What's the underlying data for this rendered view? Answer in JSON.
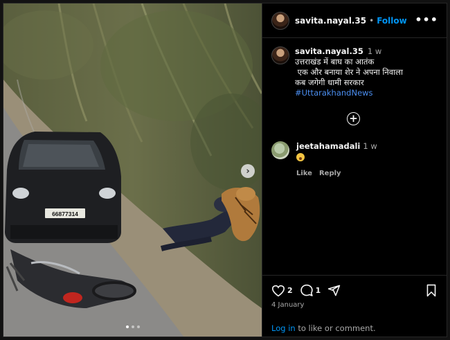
{
  "post": {
    "username": "savita.nayal.35",
    "separator": "•",
    "follow_label": "Follow",
    "more_label": "•••"
  },
  "caption": {
    "username": "savita.nayal.35",
    "time": "1 w",
    "lines": [
      "उत्तराखंड में बाघ का आतंक",
      " एक और बनाया शेर ने अपना निवाला",
      "कब जगेगी धामी सरकार"
    ],
    "hashtag": "#UttarakhandNews"
  },
  "comment": {
    "username": "jeetahamadali",
    "time": "1 w",
    "emoji": "astonished-face-emoji",
    "like_label": "Like",
    "reply_label": "Reply"
  },
  "actions": {
    "like_count": "2",
    "comment_count": "1"
  },
  "date": "4 January",
  "login": {
    "link_label": "Log in",
    "rest_label": " to like or comment."
  },
  "media": {
    "next_icon": "chevron-right-icon",
    "plate_text": "66877314",
    "carousel_count": 3,
    "carousel_active": 1
  }
}
